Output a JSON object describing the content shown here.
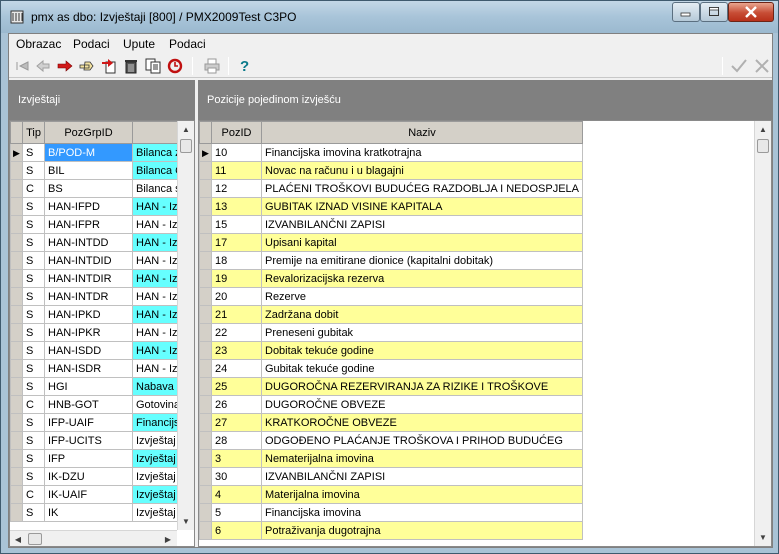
{
  "window": {
    "title": "pmx as dbo: Izvještaji [800] / PMX2009Test C3PO"
  },
  "menu": [
    "Obrazac",
    "Podaci",
    "Upute",
    "Podaci"
  ],
  "toolbar": {
    "icons": [
      "first-record-icon",
      "back-icon",
      "forward-arrow-icon",
      "hand-pointer-icon",
      "new-record-icon",
      "delete-icon",
      "copy-icon",
      "refresh-icon",
      "print-icon",
      "help-icon",
      "confirm-icon",
      "cancel-icon"
    ]
  },
  "left_pane": {
    "title": "Izvještaji",
    "columns": [
      "Tip",
      "PozGrpID",
      ""
    ],
    "rows": [
      {
        "tip": "S",
        "id": "B/POD-M",
        "naziv": "Bilanca za",
        "color": "cyan"
      },
      {
        "tip": "S",
        "id": "BIL",
        "naziv": "Bilanca G",
        "color": "cyan"
      },
      {
        "tip": "C",
        "id": "BS",
        "naziv": "Bilanca st",
        "color": "white"
      },
      {
        "tip": "S",
        "id": "HAN-IFPD",
        "naziv": "HAN - Izv",
        "color": "cyan"
      },
      {
        "tip": "S",
        "id": "HAN-IFPR",
        "naziv": "HAN - Izv",
        "color": "white"
      },
      {
        "tip": "S",
        "id": "HAN-INTDD",
        "naziv": "HAN - Izv",
        "color": "cyan"
      },
      {
        "tip": "S",
        "id": "HAN-INTDID",
        "naziv": "HAN - Izv",
        "color": "white"
      },
      {
        "tip": "S",
        "id": "HAN-INTDIR",
        "naziv": "HAN - Izv",
        "color": "cyan"
      },
      {
        "tip": "S",
        "id": "HAN-INTDR",
        "naziv": "HAN - Izv",
        "color": "white"
      },
      {
        "tip": "S",
        "id": "HAN-IPKD",
        "naziv": "HAN - Izv",
        "color": "cyan"
      },
      {
        "tip": "S",
        "id": "HAN-IPKR",
        "naziv": "HAN - Izv",
        "color": "white"
      },
      {
        "tip": "S",
        "id": "HAN-ISDD",
        "naziv": "HAN - Izv",
        "color": "cyan"
      },
      {
        "tip": "S",
        "id": "HAN-ISDR",
        "naziv": "HAN - Izv",
        "color": "white"
      },
      {
        "tip": "S",
        "id": "HGI",
        "naziv": "Nabava",
        "color": "cyan"
      },
      {
        "tip": "C",
        "id": "HNB-GOT",
        "naziv": "Gotovina",
        "color": "white"
      },
      {
        "tip": "S",
        "id": "IFP-UAIF",
        "naziv": "Financijsk",
        "color": "cyan"
      },
      {
        "tip": "S",
        "id": "IFP-UCITS",
        "naziv": "Izvještaj",
        "color": "white"
      },
      {
        "tip": "S",
        "id": "IFP",
        "naziv": "Izvještaj",
        "color": "cyan"
      },
      {
        "tip": "S",
        "id": "IK-DZU",
        "naziv": "Izvještaj",
        "color": "white"
      },
      {
        "tip": "C",
        "id": "IK-UAIF",
        "naziv": "Izvještaj",
        "color": "cyan"
      },
      {
        "tip": "S",
        "id": "IK",
        "naziv": "Izvještaj",
        "color": "white"
      }
    ]
  },
  "right_pane": {
    "title": "Pozicije pojedinom izvješću",
    "columns": [
      "PozID",
      "Naziv"
    ],
    "rows": [
      {
        "id": "10",
        "naziv": "Financijska imovina kratkotrajna",
        "color": "white"
      },
      {
        "id": "11",
        "naziv": "Novac na računu i u blagajni",
        "color": "hl"
      },
      {
        "id": "12",
        "naziv": "PLAĆENI TROŠKOVI BUDUĆEG RAZDOBLJA I NEDOSPJELA",
        "color": "white"
      },
      {
        "id": "13",
        "naziv": "GUBITAK IZNAD VISINE KAPITALA",
        "color": "hl"
      },
      {
        "id": "15",
        "naziv": "IZVANBILANČNI ZAPISI",
        "color": "white"
      },
      {
        "id": "17",
        "naziv": "Upisani kapital",
        "color": "hl"
      },
      {
        "id": "18",
        "naziv": "Premije na emitirane dionice (kapitalni dobitak)",
        "color": "white"
      },
      {
        "id": "19",
        "naziv": "Revalorizacijska rezerva",
        "color": "hl"
      },
      {
        "id": "20",
        "naziv": "Rezerve",
        "color": "white"
      },
      {
        "id": "21",
        "naziv": "Zadržana dobit",
        "color": "hl"
      },
      {
        "id": "22",
        "naziv": "Preneseni gubitak",
        "color": "white"
      },
      {
        "id": "23",
        "naziv": "Dobitak tekuće godine",
        "color": "hl"
      },
      {
        "id": "24",
        "naziv": "Gubitak tekuće godine",
        "color": "white"
      },
      {
        "id": "25",
        "naziv": "DUGOROČNA REZERVIRANJA ZA RIZIKE I TROŠKOVE",
        "color": "hl"
      },
      {
        "id": "26",
        "naziv": "DUGOROČNE OBVEZE",
        "color": "white"
      },
      {
        "id": "27",
        "naziv": "KRATKOROČNE OBVEZE",
        "color": "hl"
      },
      {
        "id": "28",
        "naziv": " ODGOĐENO PLAĆANJE TROŠKOVA I PRIHOD BUDUĆEG",
        "color": "white"
      },
      {
        "id": "3",
        "naziv": "Nematerijalna imovina",
        "color": "hl"
      },
      {
        "id": "30",
        "naziv": "IZVANBILANČNI ZAPISI",
        "color": "white"
      },
      {
        "id": "4",
        "naziv": "Materijalna imovina",
        "color": "hl"
      },
      {
        "id": "5",
        "naziv": "Financijska imovina",
        "color": "white"
      },
      {
        "id": "6",
        "naziv": "Potraživanja dugotrajna",
        "color": "hl"
      }
    ]
  }
}
